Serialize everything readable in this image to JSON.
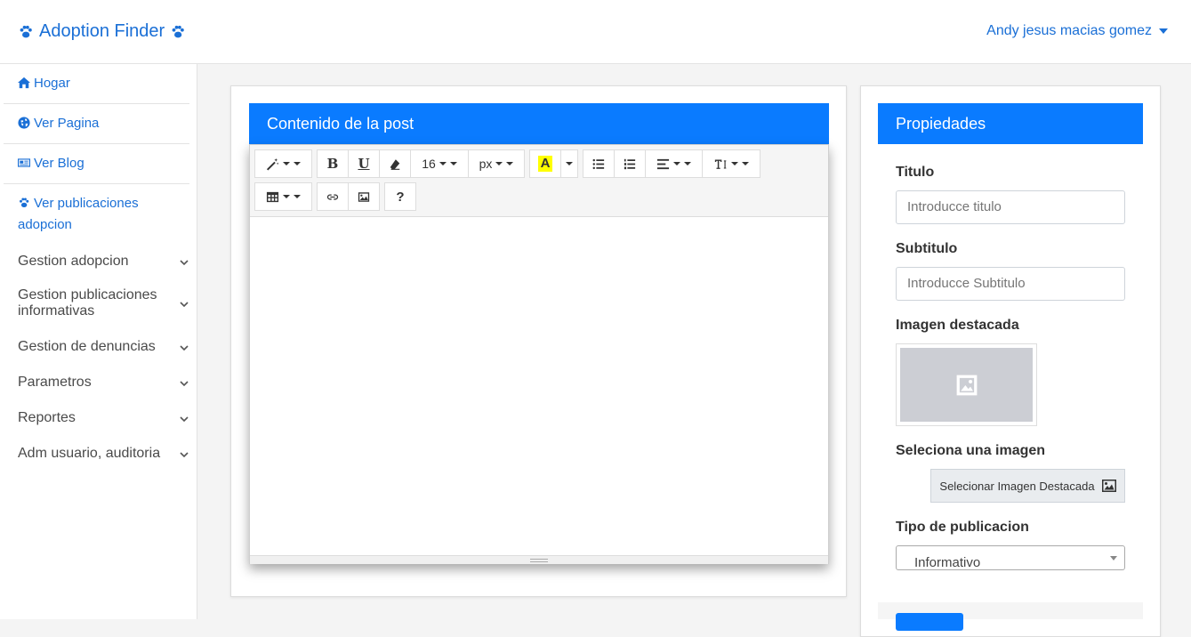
{
  "header": {
    "brand": "Adoption Finder",
    "user_name": "Andy jesus macias gomez"
  },
  "sidebar": {
    "links": [
      {
        "label": "Hogar",
        "icon": "home-icon"
      },
      {
        "label": "Ver Pagina",
        "icon": "globe-icon"
      },
      {
        "label": "Ver Blog",
        "icon": "newspaper-icon"
      },
      {
        "label": "Ver publicaciones adopcion",
        "icon": "paw-icon"
      }
    ],
    "groups": [
      "Gestion adopcion",
      "Gestion publicaciones informativas",
      "Gestion de denuncias",
      "Parametros",
      "Reportes",
      "Adm usuario, auditoria"
    ]
  },
  "editor_panel": {
    "title": "Contenido de la post",
    "font_size": "16",
    "font_unit": "px",
    "highlight_letter": "A",
    "help_label": "?"
  },
  "properties_panel": {
    "title": "Propiedades",
    "titulo_label": "Titulo",
    "titulo_placeholder": "Introducce titulo",
    "subtitulo_label": "Subtitulo",
    "subtitulo_placeholder": "Introducce Subtitulo",
    "imagen_label": "Imagen destacada",
    "selecciona_label": "Seleciona una imagen",
    "select_image_button": "Selecionar Imagen Destacada",
    "tipo_label": "Tipo de publicacion",
    "tipo_value": "Informativo"
  },
  "colors": {
    "accent": "#0a7bff",
    "link": "#1a6fd6",
    "highlight": "#ffff00"
  }
}
